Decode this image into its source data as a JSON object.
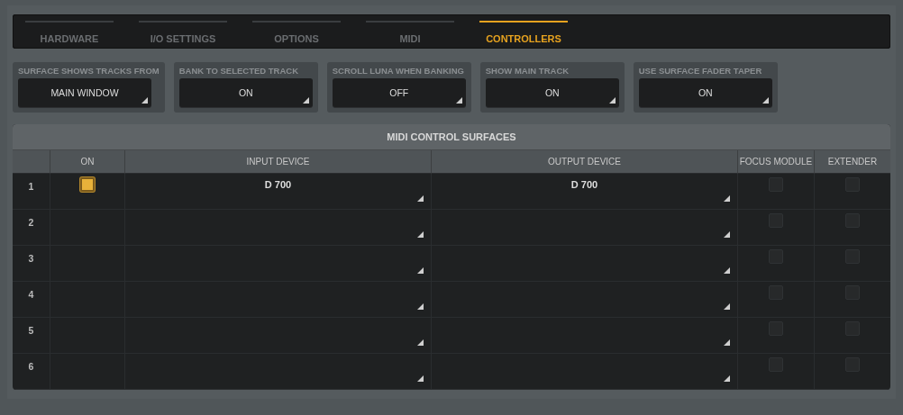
{
  "tabs": [
    {
      "label": "HARDWARE",
      "selected": false
    },
    {
      "label": "I/O SETTINGS",
      "selected": false
    },
    {
      "label": "OPTIONS",
      "selected": false
    },
    {
      "label": "MIDI",
      "selected": false
    },
    {
      "label": "CONTROLLERS",
      "selected": true
    }
  ],
  "settings": [
    {
      "label": "SURFACE SHOWS TRACKS FROM",
      "value": "MAIN WINDOW"
    },
    {
      "label": "BANK TO SELECTED TRACK",
      "value": "ON"
    },
    {
      "label": "SCROLL LUNA WHEN BANKING",
      "value": "OFF"
    },
    {
      "label": "SHOW MAIN TRACK",
      "value": "ON"
    },
    {
      "label": "USE SURFACE FADER TAPER",
      "value": "ON"
    }
  ],
  "table": {
    "title": "MIDI CONTROL SURFACES",
    "columns": [
      "ON",
      "INPUT DEVICE",
      "OUTPUT DEVICE",
      "FOCUS MODULE",
      "EXTENDER"
    ],
    "rows": [
      {
        "number": "1",
        "on": true,
        "input": "D 700",
        "output": "D 700",
        "focus_module": false,
        "extender": false
      },
      {
        "number": "2",
        "on": false,
        "focus_module": false,
        "extender": false
      },
      {
        "number": "3",
        "on": false,
        "focus_module": false,
        "extender": false
      },
      {
        "number": "4",
        "on": false,
        "focus_module": false,
        "extender": false
      },
      {
        "number": "5",
        "on": false,
        "focus_module": false,
        "extender": false
      },
      {
        "number": "6",
        "on": false,
        "focus_module": false,
        "extender": false
      }
    ]
  }
}
